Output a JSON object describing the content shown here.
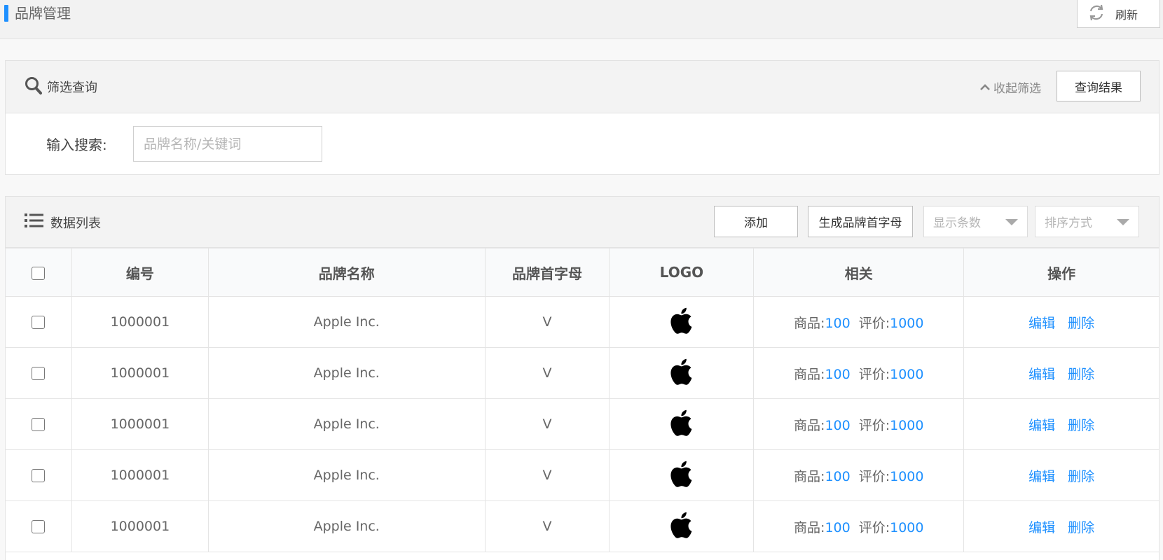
{
  "page": {
    "title": "品牌管理",
    "refresh_label": "刷新",
    "accent_color": "#1e90ff"
  },
  "filter": {
    "title": "筛选查询",
    "collapse_label": "收起筛选",
    "query_button": "查询结果",
    "search_label": "输入搜索:",
    "search_placeholder": "品牌名称/关键词",
    "search_value": ""
  },
  "list": {
    "title": "数据列表",
    "add_button": "添加",
    "generate_button": "生成品牌首字母",
    "count_select_placeholder": "显示条数",
    "sort_select_placeholder": "排序方式",
    "columns": [
      "编号",
      "品牌名称",
      "品牌首字母",
      "LOGO",
      "相关",
      "操作"
    ],
    "related_goods_label": "商品:",
    "related_review_label": "评价:",
    "edit_label": "编辑",
    "delete_label": "删除",
    "rows": [
      {
        "id": "1000001",
        "name": "Apple Inc.",
        "letter": "V",
        "logo": "apple-logo",
        "goods": "100",
        "reviews": "1000"
      },
      {
        "id": "1000001",
        "name": "Apple Inc.",
        "letter": "V",
        "logo": "apple-logo",
        "goods": "100",
        "reviews": "1000"
      },
      {
        "id": "1000001",
        "name": "Apple Inc.",
        "letter": "V",
        "logo": "apple-logo",
        "goods": "100",
        "reviews": "1000"
      },
      {
        "id": "1000001",
        "name": "Apple Inc.",
        "letter": "V",
        "logo": "apple-logo",
        "goods": "100",
        "reviews": "1000"
      },
      {
        "id": "1000001",
        "name": "Apple Inc.",
        "letter": "V",
        "logo": "apple-logo",
        "goods": "100",
        "reviews": "1000"
      }
    ]
  }
}
